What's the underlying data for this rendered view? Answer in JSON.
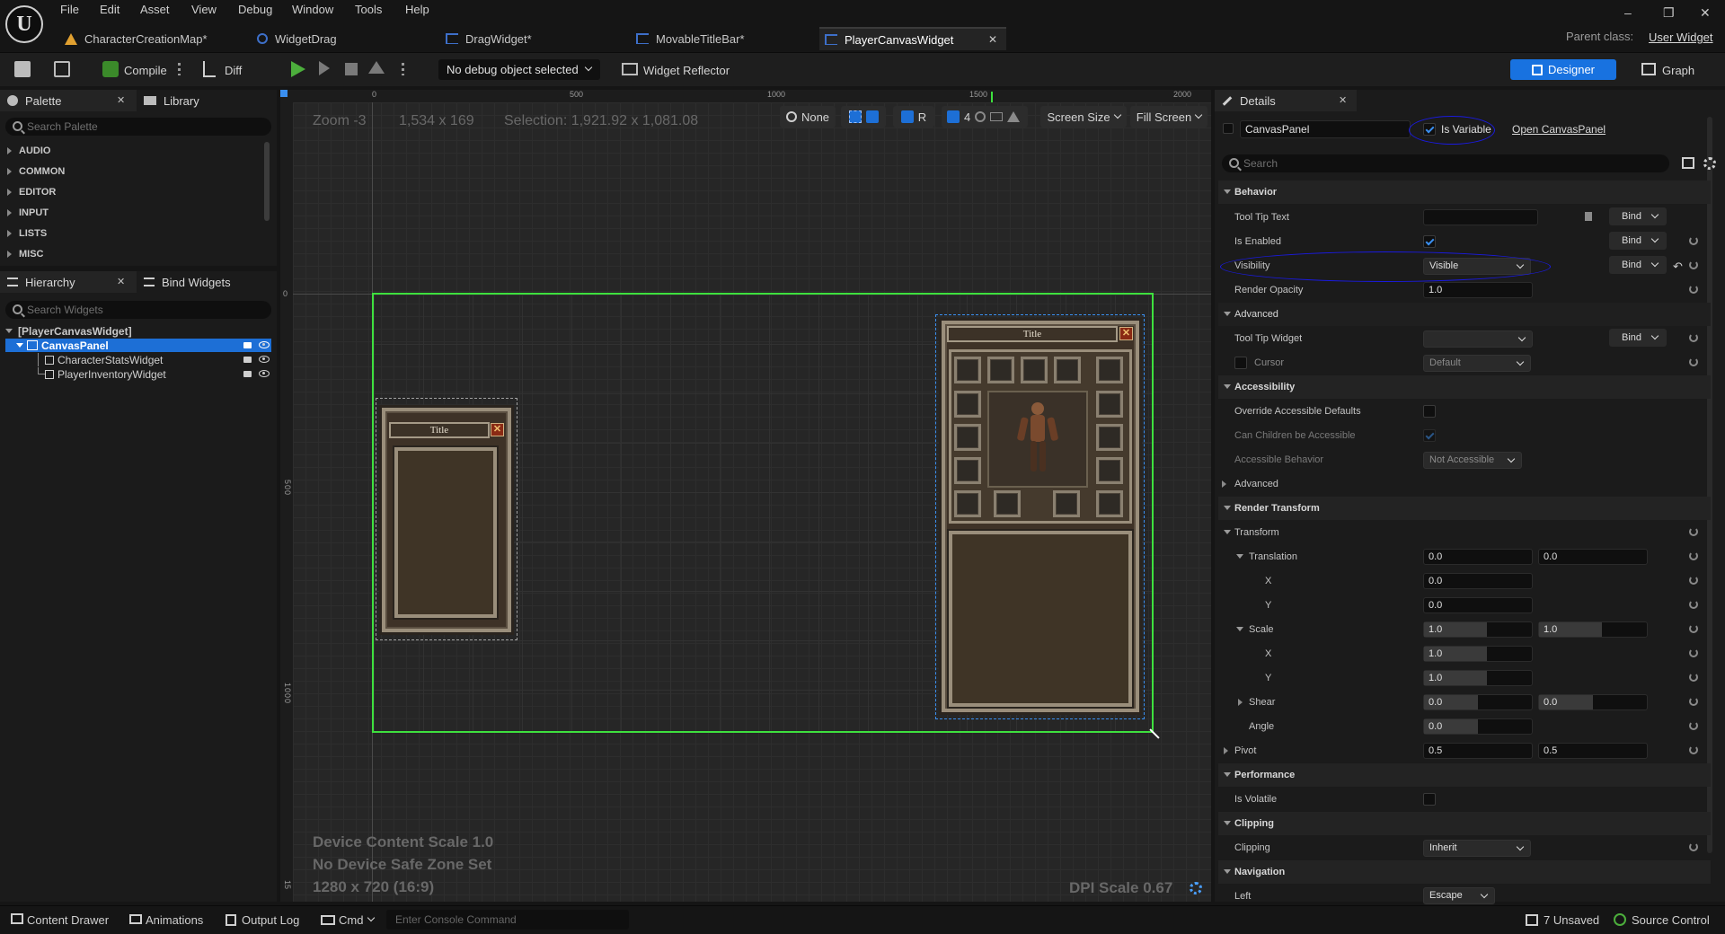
{
  "menu": {
    "items": [
      "File",
      "Edit",
      "Asset",
      "View",
      "Debug",
      "Window",
      "Tools",
      "Help"
    ],
    "parent_class_label": "Parent class:",
    "parent_class_value": "User Widget"
  },
  "tabs": [
    {
      "label": "CharacterCreationMap*"
    },
    {
      "label": "WidgetDrag"
    },
    {
      "label": "DragWidget*"
    },
    {
      "label": "MovableTitleBar*"
    },
    {
      "label": "PlayerCanvasWidget"
    }
  ],
  "toolbar": {
    "compile": "Compile",
    "diff": "Diff",
    "debug_select": "No debug object selected",
    "widget_reflector": "Widget Reflector",
    "designer": "Designer",
    "graph": "Graph"
  },
  "palette": {
    "tab_label": "Palette",
    "library_label": "Library",
    "search_placeholder": "Search Palette",
    "categories": [
      "AUDIO",
      "COMMON",
      "EDITOR",
      "INPUT",
      "LISTS",
      "MISC"
    ]
  },
  "hierarchy": {
    "tab_label": "Hierarchy",
    "bind_label": "Bind Widgets",
    "search_placeholder": "Search Widgets",
    "root": "[PlayerCanvasWidget]",
    "items": [
      "CanvasPanel",
      "CharacterStatsWidget",
      "PlayerInventoryWidget"
    ]
  },
  "viewport": {
    "zoom": "Zoom -3",
    "size": "1,534 x 169",
    "selection": "Selection: 1,921.92 x 1,081.08",
    "ruler_ticks": [
      "0",
      "500",
      "1000",
      "1500",
      "2000"
    ],
    "ruler_left_ticks": [
      "0",
      "500",
      "1000",
      "15"
    ],
    "none_label": "None",
    "r_label": "R",
    "grid_size": "4",
    "screen_size": "Screen Size",
    "fill_screen": "Fill Screen",
    "device_scale": "Device Content Scale 1.0",
    "safe_zone": "No Device Safe Zone Set",
    "resolution": "1280 x 720 (16:9)",
    "dpi": "DPI Scale 0.67",
    "stats_title": "Title",
    "inv_title": "Title"
  },
  "details": {
    "tab_label": "Details",
    "widget_name": "CanvasPanel",
    "is_variable": "Is Variable",
    "open_canvas": "Open CanvasPanel",
    "search_placeholder": "Search",
    "bind": "Bind",
    "sections": {
      "behavior": "Behavior",
      "advanced": "Advanced",
      "accessibility": "Accessibility",
      "advanced2": "Advanced",
      "render_transform": "Render Transform",
      "transform": "Transform",
      "performance": "Performance",
      "clipping": "Clipping",
      "navigation": "Navigation"
    },
    "rows": {
      "tool_tip_text": "Tool Tip Text",
      "is_enabled": "Is Enabled",
      "visibility": "Visibility",
      "visibility_value": "Visible",
      "render_opacity": "Render Opacity",
      "render_opacity_value": "1.0",
      "tool_tip_widget": "Tool Tip Widget",
      "cursor": "Cursor",
      "cursor_value": "Default",
      "override_acc": "Override Accessible Defaults",
      "can_children": "Can Children be Accessible",
      "acc_behavior": "Accessible Behavior",
      "acc_behavior_value": "Not Accessible",
      "translation": "Translation",
      "translation_x": "0.0",
      "translation_y": "0.0",
      "x": "X",
      "y": "Y",
      "tx_val": "0.0",
      "ty_val": "0.0",
      "scale": "Scale",
      "scale_x": "1.0",
      "scale_y": "1.0",
      "sx_val": "1.0",
      "sy_val": "1.0",
      "shear": "Shear",
      "shear_x": "0.0",
      "shear_y": "0.0",
      "angle": "Angle",
      "angle_val": "0.0",
      "pivot": "Pivot",
      "pivot_x": "0.5",
      "pivot_y": "0.5",
      "is_volatile": "Is Volatile",
      "clipping": "Clipping",
      "clipping_value": "Inherit",
      "left": "Left",
      "left_value": "Escape"
    }
  },
  "status": {
    "content_drawer": "Content Drawer",
    "animations": "Animations",
    "output_log": "Output Log",
    "cmd": "Cmd",
    "console_placeholder": "Enter Console Command",
    "unsaved": "7 Unsaved",
    "source_control": "Source Control"
  },
  "colors": {
    "accent": "#1872e0",
    "selection_green": "#3ee03e",
    "annotation_blue": "#1a1adf"
  }
}
